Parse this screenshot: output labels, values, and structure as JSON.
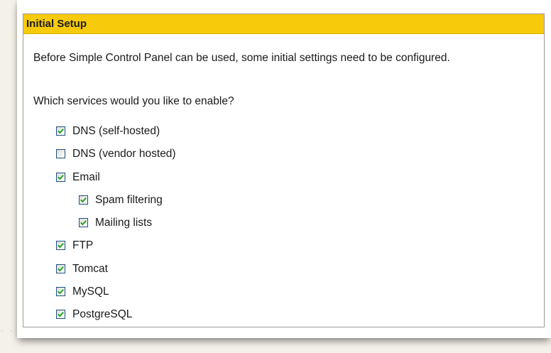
{
  "panel": {
    "title": "Initial Setup",
    "intro": "Before Simple Control Panel can be used, some initial settings need to be configured.",
    "question": "Which services would you like to enable?"
  },
  "options": [
    {
      "label": "DNS (self-hosted)",
      "checked": true,
      "level": 0
    },
    {
      "label": "DNS (vendor hosted)",
      "checked": false,
      "level": 0
    },
    {
      "label": "Email",
      "checked": true,
      "level": 0
    },
    {
      "label": "Spam filtering",
      "checked": true,
      "level": 1
    },
    {
      "label": "Mailing lists",
      "checked": true,
      "level": 1
    },
    {
      "label": "FTP",
      "checked": true,
      "level": 0
    },
    {
      "label": "Tomcat",
      "checked": true,
      "level": 0
    },
    {
      "label": "MySQL",
      "checked": true,
      "level": 0
    },
    {
      "label": "PostgreSQL",
      "checked": true,
      "level": 0
    }
  ],
  "colors": {
    "header_bg": "#f7cb0b",
    "checkmark": "#21a121",
    "checkbox_border": "#1c5180"
  },
  "icons": {
    "checkbox_checked": "checkmark-icon"
  }
}
